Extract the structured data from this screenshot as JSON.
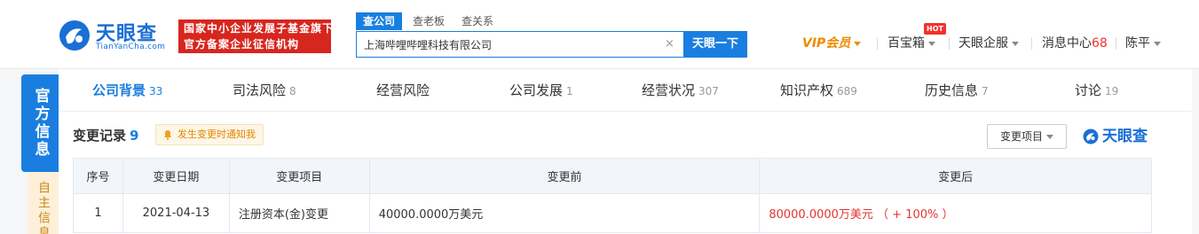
{
  "header": {
    "logo_cn": "天眼查",
    "logo_en": "TianYanCha.com",
    "badge_line1": "国家中小企业发展子基金旗下",
    "badge_line2": "官方备案企业征信机构",
    "search_tabs": [
      "查公司",
      "查老板",
      "查关系"
    ],
    "search_value": "上海哔哩哔哩科技有限公司",
    "search_button": "天眼一下",
    "vip_label": "VIP会员",
    "toolbox_label": "百宝箱",
    "hot_badge": "HOT",
    "enterprise_label": "天眼企服",
    "messages_label": "消息中心",
    "messages_count": "68",
    "user_name": "陈平"
  },
  "side_tabs": {
    "official": "官方信息",
    "self": "自主信息"
  },
  "tabs": [
    {
      "label": "公司背景",
      "count": "33"
    },
    {
      "label": "司法风险",
      "count": "8"
    },
    {
      "label": "经营风险",
      "count": ""
    },
    {
      "label": "公司发展",
      "count": "1"
    },
    {
      "label": "经营状况",
      "count": "307"
    },
    {
      "label": "知识产权",
      "count": "689"
    },
    {
      "label": "历史信息",
      "count": "7"
    },
    {
      "label": "讨论",
      "count": "19"
    }
  ],
  "section": {
    "title": "变更记录",
    "count": "9",
    "notify_label": "发生变更时通知我",
    "filter_label": "变更项目",
    "watermark": "天眼查"
  },
  "table": {
    "headers": [
      "序号",
      "变更日期",
      "变更项目",
      "变更前",
      "变更后"
    ],
    "rows": [
      {
        "index": "1",
        "date": "2021-04-13",
        "item": "注册资本(金)变更",
        "before": "40000.0000万美元",
        "after": "80000.0000万美元 （ + 100% ）"
      }
    ]
  },
  "colors": {
    "brand_blue": "#1a7ee0",
    "badge_red": "#d7261e",
    "vip_orange": "#f08a00",
    "increase_red": "#e2352d"
  }
}
